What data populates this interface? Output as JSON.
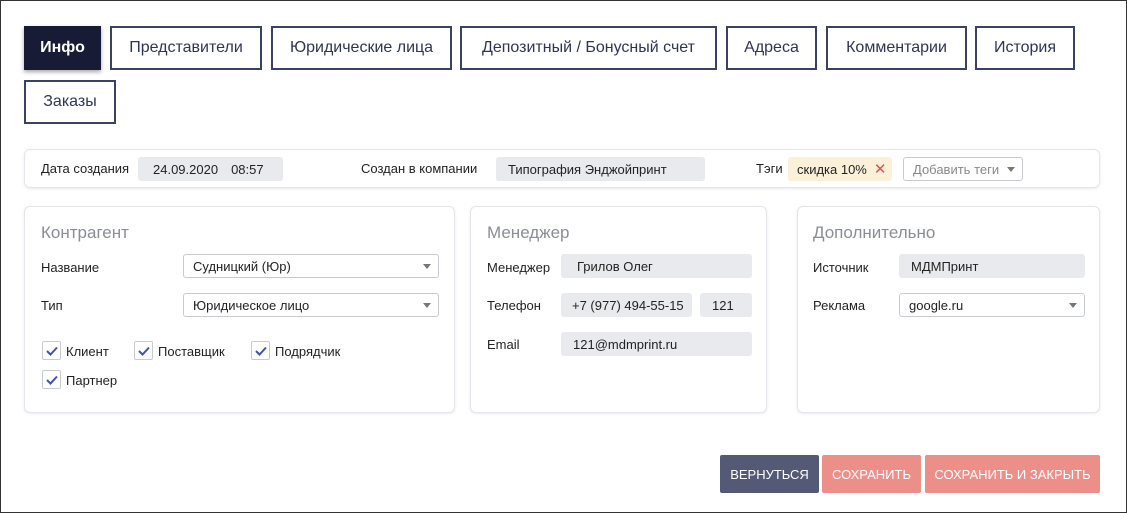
{
  "tabs": [
    {
      "label": "Инфо",
      "active": true
    },
    {
      "label": "Представители"
    },
    {
      "label": "Юридические лица"
    },
    {
      "label": "Депозитный / Бонусный счет"
    },
    {
      "label": "Адреса"
    },
    {
      "label": "Комментарии"
    },
    {
      "label": "История"
    },
    {
      "label": "Заказы"
    }
  ],
  "info_bar": {
    "created_label": "Дата создания",
    "created_date": "24.09.2020",
    "created_time": "08:57",
    "company_label": "Создан в компании",
    "company_value": "Типография Энджойпринт",
    "tags_label": "Тэги",
    "tag": "скидка 10%",
    "tag_remove": "✕",
    "add_tags_placeholder": "Добавить теги"
  },
  "counterparty": {
    "title": "Контрагент",
    "name_label": "Название",
    "name_value": "Судницкий (Юр)",
    "type_label": "Тип",
    "type_value": "Юридическое лицо",
    "checkboxes": [
      {
        "label": "Клиент",
        "checked": true
      },
      {
        "label": "Поставщик",
        "checked": true
      },
      {
        "label": "Подрядчик",
        "checked": true
      },
      {
        "label": "Партнер",
        "checked": true
      }
    ]
  },
  "manager": {
    "title": "Менеджер",
    "manager_label": "Менеджер",
    "manager_value": "Грилов Олег",
    "phone_label": "Телефон",
    "phone_value": "+7 (977) 494-55-15",
    "phone_ext": "121",
    "email_label": "Email",
    "email_value": "121@mdmprint.ru"
  },
  "extra": {
    "title": "Дополнительно",
    "source_label": "Источник",
    "source_value": "МДМПринт",
    "ads_label": "Реклама",
    "ads_value": "google.ru"
  },
  "actions": {
    "back": "ВЕРНУТЬСЯ",
    "save": "СОХРАНИТЬ",
    "save_close": "СОХРАНИТЬ И ЗАКРЫТЬ"
  },
  "colors": {
    "active_tab": "#171b36",
    "tab_border": "#3b4160",
    "back_button": "#545a76",
    "save_button": "#ec8f88",
    "tag_bg": "#fbf1d8",
    "checkbox_check": "#3f51b5"
  }
}
